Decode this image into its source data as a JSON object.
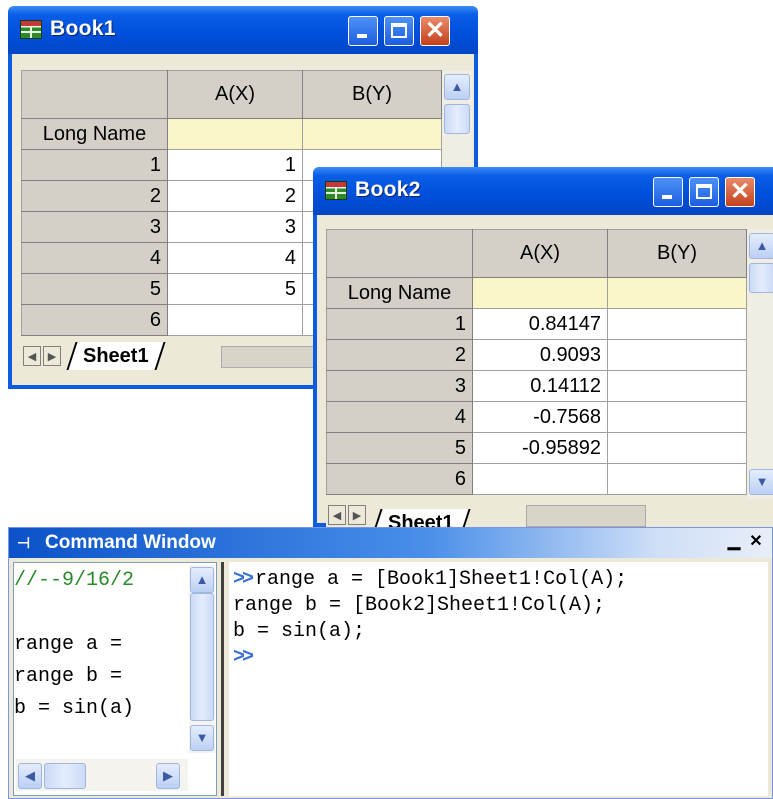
{
  "book1": {
    "title": "Book1",
    "columns": [
      "A(X)",
      "B(Y)"
    ],
    "long_name_label": "Long Name",
    "rows": [
      {
        "n": "1",
        "a": "1",
        "b": ""
      },
      {
        "n": "2",
        "a": "2",
        "b": ""
      },
      {
        "n": "3",
        "a": "3",
        "b": ""
      },
      {
        "n": "4",
        "a": "4",
        "b": ""
      },
      {
        "n": "5",
        "a": "5",
        "b": ""
      },
      {
        "n": "6",
        "a": "",
        "b": ""
      }
    ],
    "sheet_tab": "Sheet1"
  },
  "book2": {
    "title": "Book2",
    "columns": [
      "A(X)",
      "B(Y)"
    ],
    "long_name_label": "Long Name",
    "rows": [
      {
        "n": "1",
        "a": "0.84147",
        "b": ""
      },
      {
        "n": "2",
        "a": "0.9093",
        "b": ""
      },
      {
        "n": "3",
        "a": "0.14112",
        "b": ""
      },
      {
        "n": "4",
        "a": "-0.7568",
        "b": ""
      },
      {
        "n": "5",
        "a": "-0.95892",
        "b": ""
      },
      {
        "n": "6",
        "a": "",
        "b": ""
      }
    ],
    "sheet_tab": "Sheet1"
  },
  "command_window": {
    "title": "Command Window",
    "history": [
      "//--9/16/2",
      "range a =",
      "range b =",
      "b = sin(a)"
    ],
    "prompt": ">>",
    "lines": [
      "range a = [Book1]Sheet1!Col(A);",
      "range b = [Book2]Sheet1!Col(A);",
      "b = sin(a);"
    ]
  },
  "icons": {
    "minimize": "minimize-icon",
    "maximize": "maximize-icon",
    "close": "close-icon",
    "workbook": "workbook-icon",
    "pin": "pin-icon"
  },
  "colors": {
    "title_blue": "#0050dc",
    "long_name_fill": "#fbf6c8",
    "close_red": "#c4411c",
    "history_date": "#2a8a2a"
  }
}
